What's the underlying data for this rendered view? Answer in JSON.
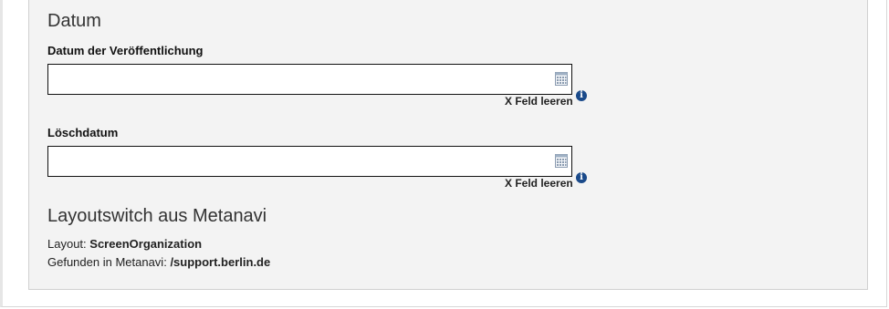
{
  "datum": {
    "heading": "Datum",
    "publish": {
      "label": "Datum der Veröffentlichung",
      "value": "",
      "clear_label": "X Feld leeren"
    },
    "delete": {
      "label": "Löschdatum",
      "value": "",
      "clear_label": "X Feld leeren"
    }
  },
  "layoutswitch": {
    "heading": "Layoutswitch aus Metanavi",
    "layout_label": "Layout:",
    "layout_value": "ScreenOrganization",
    "found_label": "Gefunden in Metanavi:",
    "found_value": "/support.berlin.de"
  },
  "icons": {
    "calendar": "calendar-icon",
    "info": "info-icon"
  },
  "colors": {
    "panel_bg": "#f3f3f3",
    "info_blue": "#1a4a8a"
  }
}
